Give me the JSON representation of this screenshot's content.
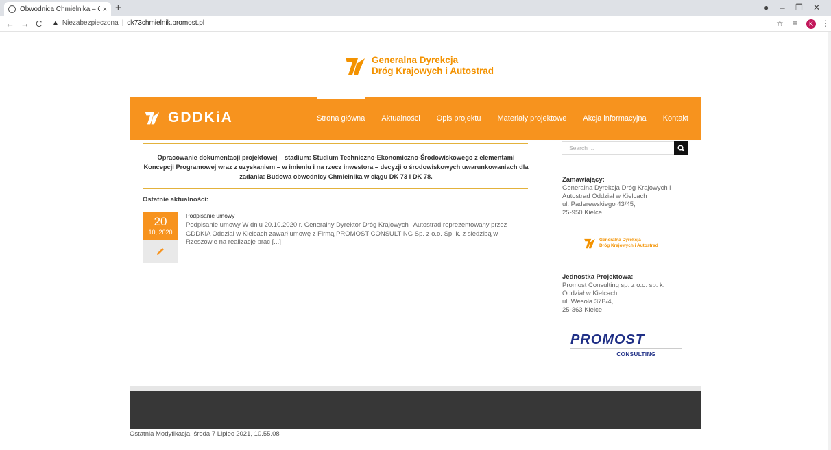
{
  "browser": {
    "tab_title": "Obwodnica Chmielnika – Obwod",
    "tab_close": "×",
    "new_tab": "+",
    "security_label": "Niezabezpieczona",
    "url": "dk73chmielnik.promost.pl",
    "profile_initial": "K"
  },
  "header": {
    "org_line1": "Generalna Dyrekcja",
    "org_line2": "Dróg Krajowych i Autostrad",
    "brand": "GDDKiA"
  },
  "nav": {
    "items": [
      "Strona główna",
      "Aktualności",
      "Opis projektu",
      "Materiały projektowe",
      "Akcja informacyjna",
      "Kontakt"
    ],
    "active_index": 0
  },
  "main": {
    "intro": "Opracowanie dokumentacji projektowej – stadium: Studium Techniczno-Ekonomiczno-Środowiskowego z elementami Koncepcji Programowej wraz z uzyskaniem – w imieniu i na rzecz inwestora – decyzji o środowiskowych uwarunkowaniach dla zadania: Budowa obwodnicy Chmielnika w ciągu DK 73 i DK 78.",
    "latest_heading": "Ostatnie aktualności:",
    "post": {
      "day": "20",
      "month_year": "10, 2020",
      "title": "Podpisanie umowy",
      "excerpt": "Podpisanie umowy W dniu 20.10.2020 r. Generalny Dyrektor Dróg Krajowych i Autostrad reprezentowany przez GDDKIA Oddział w Kielcach zawarł umowę z Firmą PROMOST CONSULTING Sp. z o.o. Sp. k. z siedzibą w Rzeszowie na realizację prac [...]"
    }
  },
  "sidebar": {
    "search_placeholder": "Search ...",
    "client_heading": "Zamawiający:",
    "client_lines": [
      "Generalna Dyrekcja Dróg Krajowych i",
      "Autostrad Oddział w Kielcach",
      "ul. Paderewskiego 43/45,",
      "25-950 Kielce"
    ],
    "logo_line1": "Generalna Dyrekcja",
    "logo_line2": "Dróg Krajowych i Autostrad",
    "unit_heading": "Jednostka Projektowa:",
    "unit_lines": [
      "Promost Consulting sp. z o.o. sp. k.",
      "Oddział w Kielcach",
      "ul. Wesoła 37B/4,",
      "25-363 Kielce"
    ],
    "promost_name": "PROMOST",
    "promost_sub": "CONSULTING"
  },
  "footer": {
    "modified": "Ostatnia Modyfikacja: środa 7 Lipiec 2021, 10.55.08"
  },
  "colors": {
    "accent": "#f7931e",
    "footer_bg": "#373737",
    "promost_blue": "#1f2f86"
  }
}
